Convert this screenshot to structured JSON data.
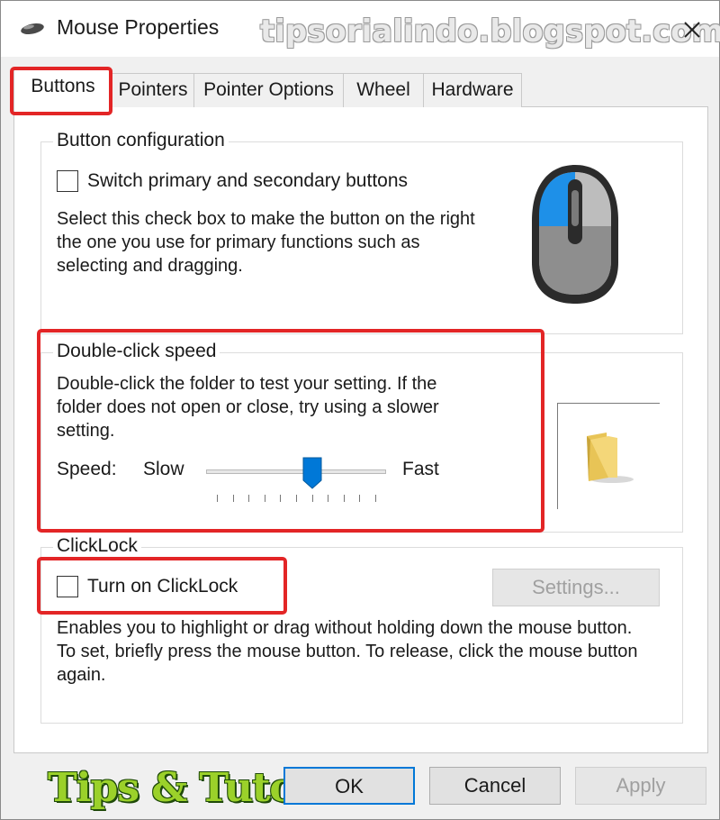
{
  "window": {
    "title": "Mouse Properties",
    "watermark": "tipsorialindo.blogspot.com"
  },
  "tabs": [
    {
      "label": "Buttons",
      "active": true
    },
    {
      "label": "Pointers",
      "active": false
    },
    {
      "label": "Pointer Options",
      "active": false
    },
    {
      "label": "Wheel",
      "active": false
    },
    {
      "label": "Hardware",
      "active": false
    }
  ],
  "button_config": {
    "legend": "Button configuration",
    "switch_label": "Switch primary and secondary buttons",
    "switch_checked": false,
    "description": "Select this check box to make the button on the right the one you use for primary functions such as selecting and dragging."
  },
  "double_click": {
    "legend": "Double-click speed",
    "description": "Double-click the folder to test your setting. If the folder does not open or close, try using a slower setting.",
    "speed_label": "Speed:",
    "slow_label": "Slow",
    "fast_label": "Fast",
    "speed_fraction": 0.6,
    "tick_count": 11
  },
  "clicklock": {
    "legend": "ClickLock",
    "toggle_label": "Turn on ClickLock",
    "checked": false,
    "settings_label": "Settings...",
    "description": "Enables you to highlight or drag without holding down the mouse button. To set, briefly press the mouse button. To release, click the mouse button again."
  },
  "footer": {
    "ok_label": "OK",
    "cancel_label": "Cancel",
    "apply_label": "Apply",
    "logo_text": "Tips & Tutorial"
  },
  "colors": {
    "accent": "#0078d7",
    "highlight": "#e32526",
    "mouse_blue": "#1e90e8"
  },
  "icons": {
    "title": "mouse-icon",
    "close": "close-icon",
    "mouse_illustration": "mouse-illustration-icon",
    "folder": "folder-icon"
  }
}
